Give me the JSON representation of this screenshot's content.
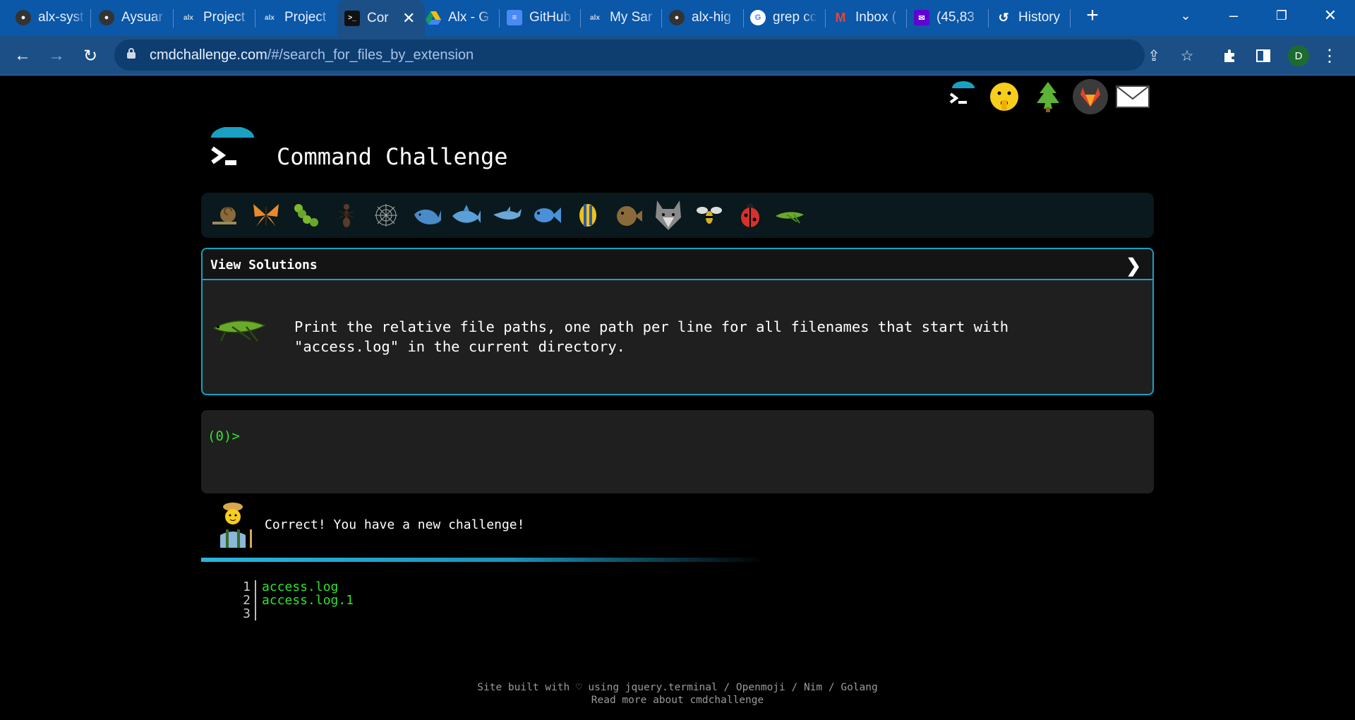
{
  "browser": {
    "tabs": [
      {
        "title": "alx-syst",
        "icon": "github-icon"
      },
      {
        "title": "Aysuar",
        "icon": "github-icon"
      },
      {
        "title": "Project",
        "icon": "alx-icon"
      },
      {
        "title": "Project",
        "icon": "alx-icon"
      },
      {
        "title": "Cor",
        "icon": "terminal-icon",
        "active": true
      },
      {
        "title": "Alx - G",
        "icon": "google-drive-icon"
      },
      {
        "title": "GitHub",
        "icon": "google-docs-icon"
      },
      {
        "title": "My Sar",
        "icon": "alx-icon"
      },
      {
        "title": "alx-hig",
        "icon": "github-icon"
      },
      {
        "title": "grep cc",
        "icon": "google-icon"
      },
      {
        "title": "Inbox (",
        "icon": "gmail-icon"
      },
      {
        "title": "(45,83",
        "icon": "yahoo-mail-icon"
      },
      {
        "title": "History",
        "icon": "history-icon"
      }
    ],
    "favicon_text": {
      "alx": "alx"
    },
    "url_host": "cmdchallenge.com",
    "url_path": "/#/search_for_files_by_extension",
    "avatar_letter": "D",
    "colors": {
      "tabbar": "#0b57a8",
      "toolbar": "#1c4f86",
      "avatar": "#1e6b2f"
    }
  },
  "page": {
    "title": "Command Challenge",
    "top_icons": [
      "terminal-icon",
      "shushing-face-icon",
      "tree-icon",
      "gitlab-icon",
      "mail-icon"
    ],
    "level_icons": [
      "snail-icon",
      "butterfly-icon",
      "caterpillar-icon",
      "ant-icon",
      "spider-web-icon",
      "whale-icon",
      "shark-icon",
      "dolphin-icon",
      "fish-icon",
      "tropical-fish-icon",
      "blowfish-icon",
      "wolf-icon",
      "bee-icon",
      "ladybug-icon",
      "cricket-icon"
    ],
    "solutions_label": "View Solutions",
    "solutions_chevron": "❯",
    "challenge_text": "Print the relative file paths, one path per line for all filenames that start with \"access.log\" in the current directory.",
    "prompt": "(0)>",
    "result_message": "Correct! You have a new challenge!",
    "progress_fraction": 0.4,
    "output_lines": [
      {
        "n": "1",
        "text": "access.log"
      },
      {
        "n": "2",
        "text": "access.log.1"
      },
      {
        "n": "3",
        "text": ""
      }
    ],
    "footer_line1": "Site built with ♡ using jquery.terminal / Openmoji / Nim / Golang",
    "footer_line2": "Read more about cmdchallenge",
    "colors": {
      "accent": "#1aa0c2",
      "prompt": "#2fe12f",
      "panel": "#1f1f1f"
    }
  }
}
